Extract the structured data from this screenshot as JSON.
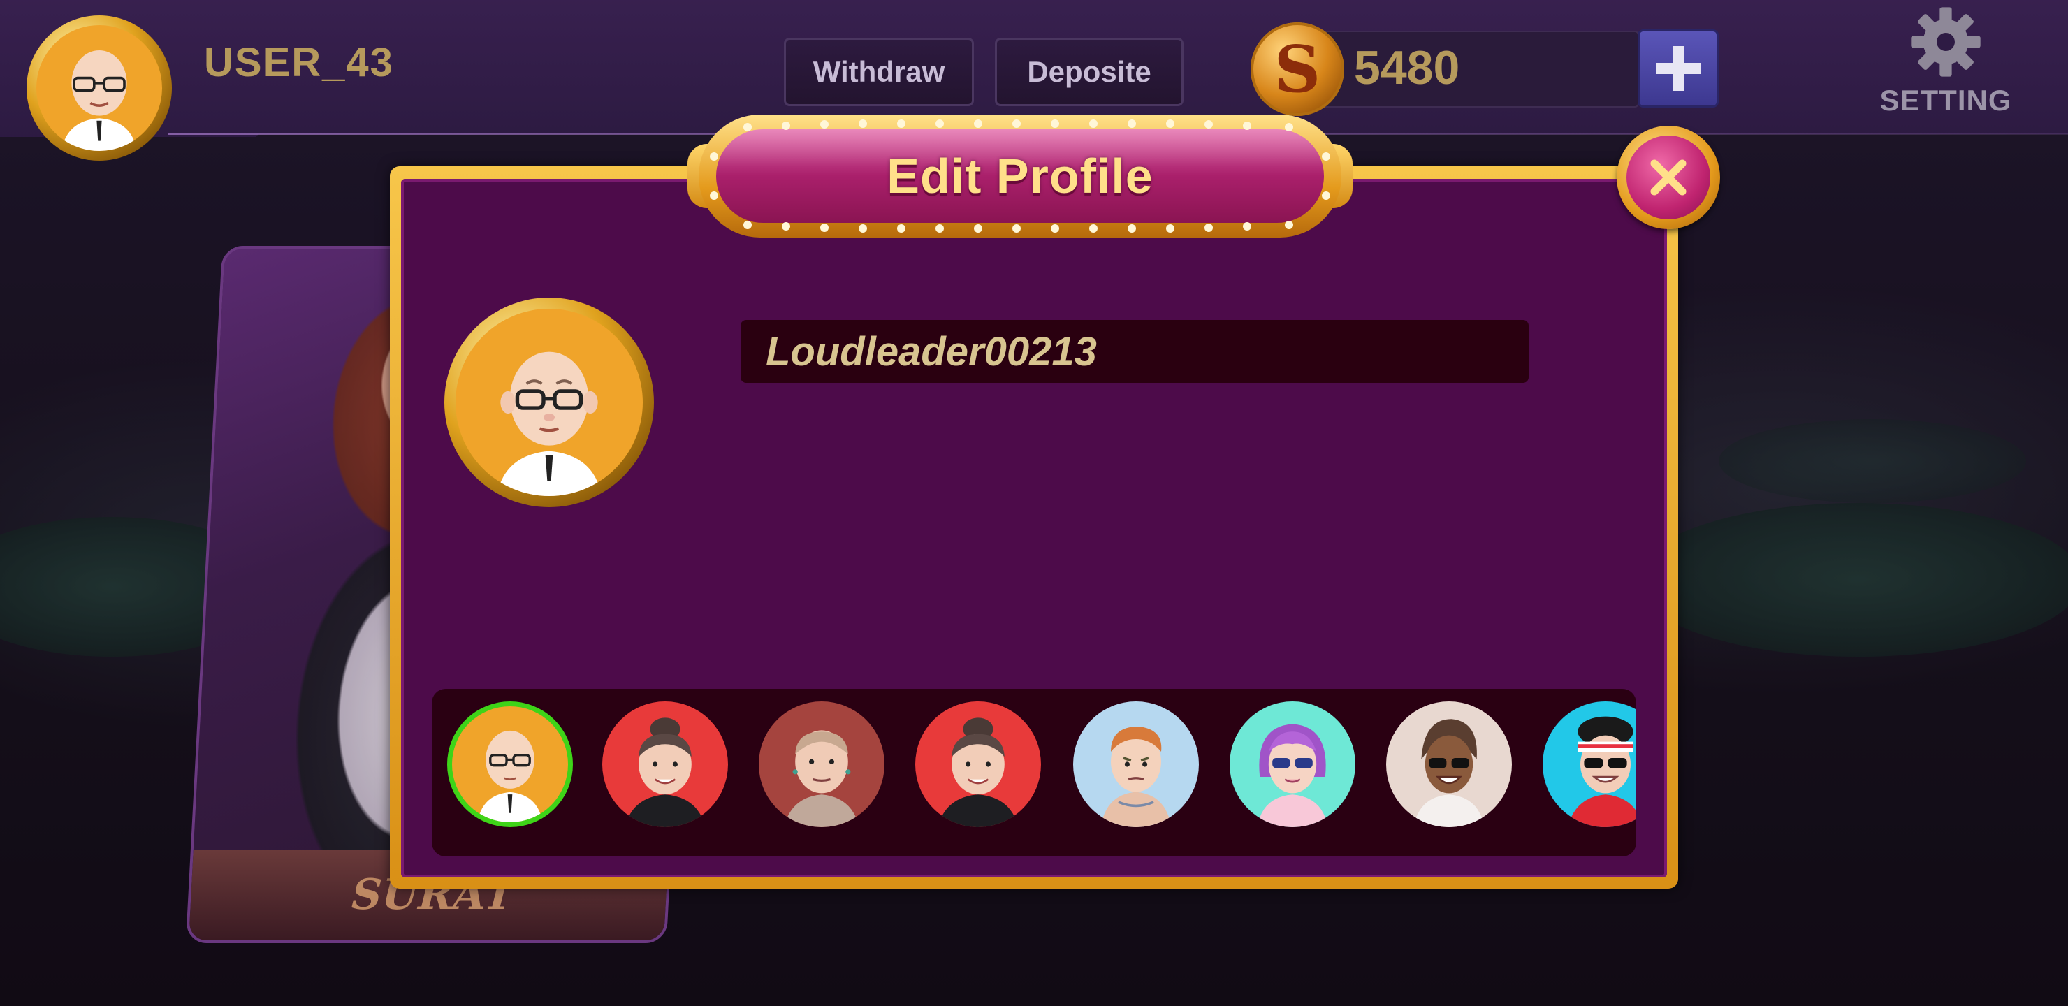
{
  "header": {
    "username": "USER_43",
    "withdraw_label": "Withdraw",
    "deposit_label": "Deposite",
    "coin_symbol": "S",
    "balance": "5480",
    "setting_label": "SETTING"
  },
  "background_card": {
    "label": "SURAT"
  },
  "modal": {
    "title": "Edit Profile",
    "name_value": "Loudleader00213",
    "selected_avatar_index": 0,
    "avatars": [
      {
        "name": "bald-glasses",
        "bg": "#f0a42a",
        "selected": true
      },
      {
        "name": "man-bun-red",
        "bg": "#e83a3a",
        "selected": false
      },
      {
        "name": "buzzcut-brown",
        "bg": "#a5443e",
        "selected": false
      },
      {
        "name": "man-bun-red-2",
        "bg": "#e83a3a",
        "selected": false
      },
      {
        "name": "ginger-tattoo",
        "bg": "#b6d8f0",
        "selected": false
      },
      {
        "name": "purple-hair-sunglasses",
        "bg": "#6ee8d6",
        "selected": false
      },
      {
        "name": "braids-sunglasses",
        "bg": "#e8d8d0",
        "selected": false
      },
      {
        "name": "headband-sunglasses",
        "bg": "#22c8e8",
        "selected": false
      }
    ]
  },
  "colors": {
    "modal_bg": "#4d0b4a",
    "gold": "#e49a1c",
    "selected_ring": "#3ed418"
  }
}
